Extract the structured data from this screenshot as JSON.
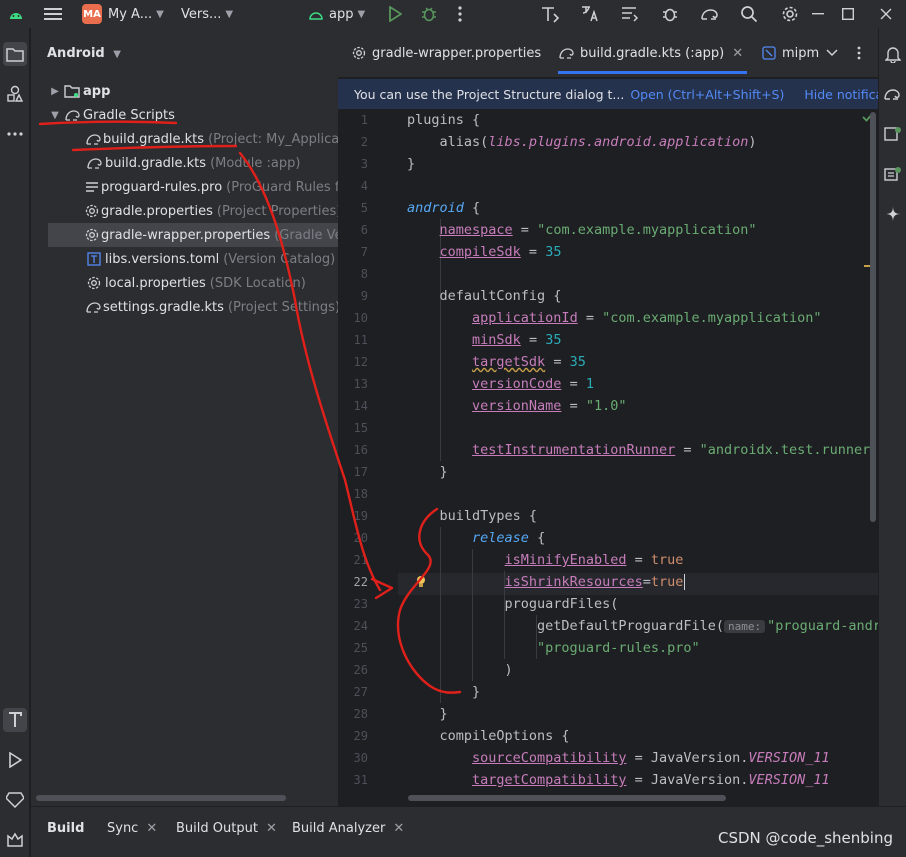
{
  "titlebar": {
    "project_badge": "MA",
    "project_name": "My A...",
    "vcs": "Vers...",
    "run_config": "app",
    "window_buttons": [
      "minimize",
      "maximize",
      "close"
    ]
  },
  "project_panel": {
    "title": "Android",
    "items": [
      {
        "label": "app",
        "hint": "",
        "bold": true
      },
      {
        "label": "Gradle Scripts",
        "hint": ""
      },
      {
        "label": "build.gradle.kts",
        "hint": "(Project: My_Applicatio"
      },
      {
        "label": "build.gradle.kts",
        "hint": "(Module :app)"
      },
      {
        "label": "proguard-rules.pro",
        "hint": "(ProGuard Rules for"
      },
      {
        "label": "gradle.properties",
        "hint": "(Project Properties)"
      },
      {
        "label": "gradle-wrapper.properties",
        "hint": "(Gradle Vers"
      },
      {
        "label": "libs.versions.toml",
        "hint": "(Version Catalog)"
      },
      {
        "label": "local.properties",
        "hint": "(SDK Location)"
      },
      {
        "label": "settings.gradle.kts",
        "hint": "(Project Settings)"
      }
    ]
  },
  "tabs": [
    {
      "label": "gradle-wrapper.properties"
    },
    {
      "label": "build.gradle.kts (:app)"
    },
    {
      "label": "mipm"
    }
  ],
  "notification": {
    "text": "You can use the Project Structure dialog t...",
    "open_link": "Open (Ctrl+Alt+Shift+S)",
    "hide_link": "Hide notification"
  },
  "editor": {
    "line_numbers": [
      "1",
      "2",
      "3",
      "4",
      "5",
      "6",
      "7",
      "8",
      "9",
      "10",
      "11",
      "12",
      "13",
      "14",
      "15",
      "16",
      "17",
      "18",
      "19",
      "20",
      "21",
      "22",
      "23",
      "24",
      "25",
      "26",
      "27",
      "28",
      "29",
      "30",
      "31"
    ],
    "current_line": "22",
    "lines": {
      "l1_kw": "plugins {",
      "l2_a": "alias(",
      "l2_b": "libs.plugins.android.application",
      "l2_c": ")",
      "l3": "}",
      "l5_a": "android",
      "l5_b": " {",
      "l6_a": "namespace",
      "l6_b": " = ",
      "l6_c": "\"com.example.myapplication\"",
      "l7_a": "compileSdk",
      "l7_b": " = ",
      "l7_c": "35",
      "l9": "defaultConfig {",
      "l10_a": "applicationId",
      "l10_b": " = ",
      "l10_c": "\"com.example.myapplication\"",
      "l11_a": "minSdk",
      "l11_b": " = ",
      "l11_c": "35",
      "l12_a": "targetSdk",
      "l12_b": " = ",
      "l12_c": "35",
      "l13_a": "versionCode",
      "l13_b": " = ",
      "l13_c": "1",
      "l14_a": "versionName",
      "l14_b": " = ",
      "l14_c": "\"1.0\"",
      "l16_a": "testInstrumentationRunner",
      "l16_b": " = ",
      "l16_c": "\"androidx.test.runner.A",
      "l17": "}",
      "l19": "buildTypes {",
      "l20_a": "release",
      "l20_b": " {",
      "l21_a": "isMinifyEnabled",
      "l21_b": " = ",
      "l21_c": "true",
      "l22_a": "isShrinkResources",
      "l22_b": "=",
      "l22_c": "true",
      "l23": "proguardFiles(",
      "l24_a": "getDefaultProguardFile(",
      "l24_hint": "name:",
      "l24_b": "\"proguard-andr",
      "l25": "\"proguard-rules.pro\"",
      "l26": ")",
      "l27": "}",
      "l28": "}",
      "l29": "compileOptions {",
      "l30_a": "sourceCompatibility",
      "l30_b": " = JavaVersion.",
      "l30_c": "VERSION_11",
      "l31_a": "targetCompatibility",
      "l31_b": " = JavaVersion.",
      "l31_c": "VERSION_11"
    }
  },
  "bottom_tabs": [
    {
      "label": "Build"
    },
    {
      "label": "Sync"
    },
    {
      "label": "Build Output"
    },
    {
      "label": "Build Analyzer"
    }
  ],
  "watermark": "CSDN @code_shenbing",
  "colors": {
    "annotation": "#e0201a",
    "accent": "#3574f0"
  }
}
